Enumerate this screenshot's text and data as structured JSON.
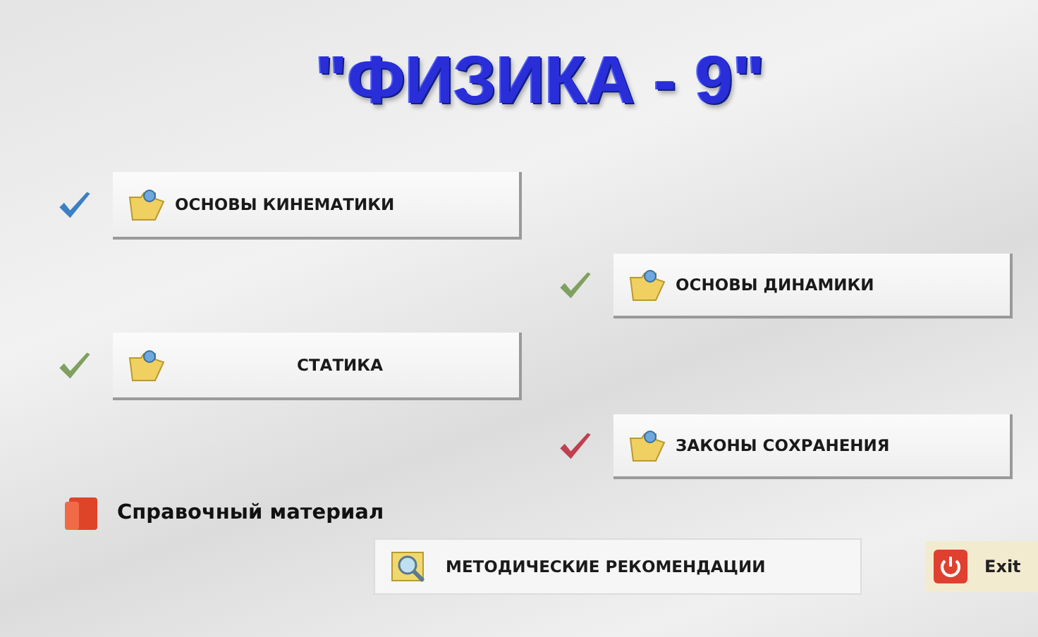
{
  "title": "\"ФИЗИКА - 9\"",
  "topics": [
    {
      "label": "ОСНОВЫ КИНЕМАТИКИ",
      "color": "#3b7fc4",
      "kind": "left"
    },
    {
      "label": "ОСНОВЫ ДИНАМИКИ",
      "color": "#7fa060",
      "kind": "right"
    },
    {
      "label": "СТАТИКА",
      "color": "#7fa060",
      "kind": "left"
    },
    {
      "label": "ЗАКОНЫ СОХРАНЕНИЯ",
      "color": "#c04050",
      "kind": "right"
    }
  ],
  "reference": {
    "label": "Справочный материал"
  },
  "methods_button": {
    "label": "МЕТОДИЧЕСКИЕ РЕКОМЕНДАЦИИ"
  },
  "exit_button": {
    "label": "Exit"
  }
}
